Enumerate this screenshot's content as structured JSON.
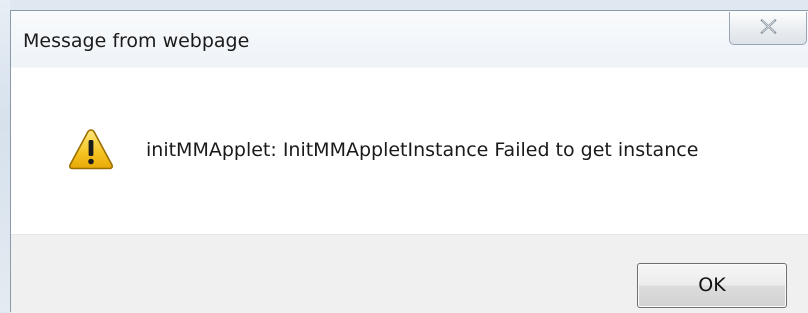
{
  "dialog": {
    "title": "Message from webpage",
    "message": "initMMApplet: InitMMAppletInstance Failed to get instance",
    "ok_label": "OK",
    "icons": {
      "close": "close-icon",
      "warning": "warning-icon"
    }
  },
  "colors": {
    "warning_fill": "#f5c321",
    "warning_border": "#9a6e00",
    "content_bg": "#ffffff",
    "footer_bg": "#f0f0f0"
  }
}
